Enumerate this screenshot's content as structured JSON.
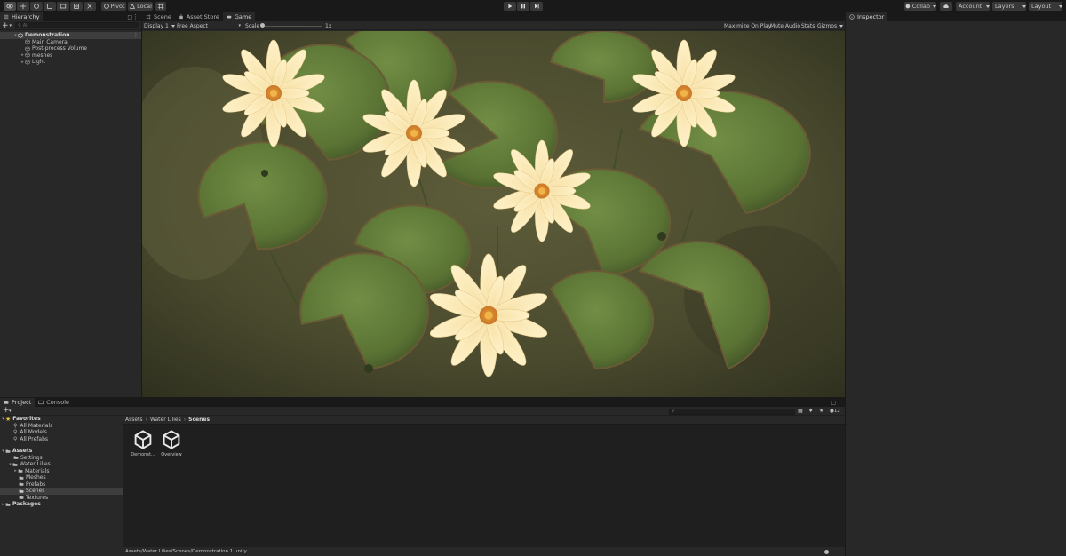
{
  "toolbar": {
    "pivot": "Pivot",
    "local": "Local",
    "collab": "Collab",
    "account": "Account",
    "layers": "Layers",
    "layout": "Layout"
  },
  "hierarchy": {
    "tab": "Hierarchy",
    "search_placeholder": "All",
    "scene": "Demonstration",
    "items": [
      "Main Camera",
      "Post-process Volume",
      "meshes",
      "Light"
    ]
  },
  "center_tabs": [
    "Scene",
    "Asset Store",
    "Game"
  ],
  "game": {
    "display": "Display 1",
    "aspect": "Free Aspect",
    "scale_label": "Scale",
    "scale_value": "1x",
    "maximize": "Maximize On Play",
    "mute": "Mute Audio",
    "stats": "Stats",
    "gizmos": "Gizmos"
  },
  "inspector": {
    "tab": "Inspector"
  },
  "project": {
    "tabs": [
      "Project",
      "Console"
    ],
    "favorites": {
      "label": "Favorites",
      "items": [
        "All Materials",
        "All Models",
        "All Prefabs"
      ]
    },
    "assets": {
      "label": "Assets",
      "settings": "Settings",
      "water_lilies": "Water Lilies",
      "children": [
        "Materials",
        "Meshes",
        "Prefabs",
        "Scenes",
        "Textures"
      ]
    },
    "packages": "Packages",
    "breadcrumb": [
      "Assets",
      "Water Lilies",
      "Scenes"
    ],
    "files": [
      "Demonst...",
      "Overview"
    ],
    "count": "12",
    "path": "Assets/Water Lilies/Scenes/Demonstration 1.unity"
  },
  "colors": {
    "background": "#191919",
    "panel": "#282828",
    "selection": "#3e3e3e",
    "pad_green": "#5e7a3a",
    "flower": "#f5dfa4"
  }
}
